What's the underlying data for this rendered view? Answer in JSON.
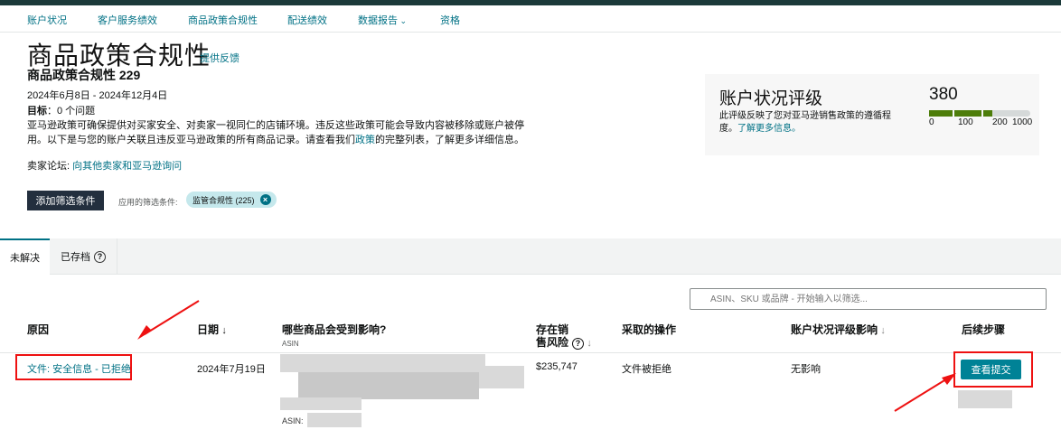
{
  "nav": {
    "items": [
      "账户状况",
      "客户服务绩效",
      "商品政策合规性",
      "配送绩效",
      "数据报告",
      "资格"
    ]
  },
  "page": {
    "title": "商品政策合规性",
    "feedback": "提供反馈",
    "subtitle": "商品政策合规性 229",
    "dates": "2024年6月8日 - 2024年12月4日",
    "goal_label": "目标",
    "goal_value": "：0 个问题",
    "desc_1": "亚马逊政策可确保提供对买家安全、对卖家一视同仁的店铺环境。违反这些政策可能会导致内容被移除或账户被停用。以下是与您的账户关联且违反亚马逊政策的所有商品记录。请查看我们",
    "desc_link": "政策",
    "desc_2": "的完整列表，了解更多详细信息。",
    "forum_label": "卖家论坛:",
    "forum_link": "向其他卖家和亚马逊询问"
  },
  "filters": {
    "add_button": "添加筛选条件",
    "applied_label": "应用的筛选条件:",
    "chip": "监管合规性 (225)"
  },
  "rating": {
    "title": "账户状况评级",
    "desc": "此评级反映了您对亚马逊销售政策的遵循程度。",
    "learn_more": "了解更多信息。",
    "score": "380",
    "score_value": 380,
    "scale": [
      "0",
      "100",
      "200",
      "1000"
    ],
    "colors": {
      "good": "#4d7d0a",
      "empty": "#d5d9d9"
    }
  },
  "tabs": [
    {
      "label": "未解决"
    },
    {
      "label": "已存档"
    }
  ],
  "search": {
    "placeholder": "ASIN、SKU 或品牌 - 开始输入以筛选..."
  },
  "table": {
    "headers": {
      "reason": "原因",
      "date": "日期",
      "affected": "哪些商品会受到影响?",
      "affected_sub": "ASIN",
      "risk_1": "存在销",
      "risk_2": "售风险",
      "action": "采取的操作",
      "impact": "账户状况评级影响",
      "next": "后续步骤"
    },
    "rows": [
      {
        "reason": "文件: 安全信息 - 已拒绝",
        "date": "2024年7月19日",
        "asin_label": "ASIN:",
        "risk": "$235,747",
        "action": "文件被拒绝",
        "impact": "无影响",
        "next_button": "查看提交"
      }
    ]
  }
}
